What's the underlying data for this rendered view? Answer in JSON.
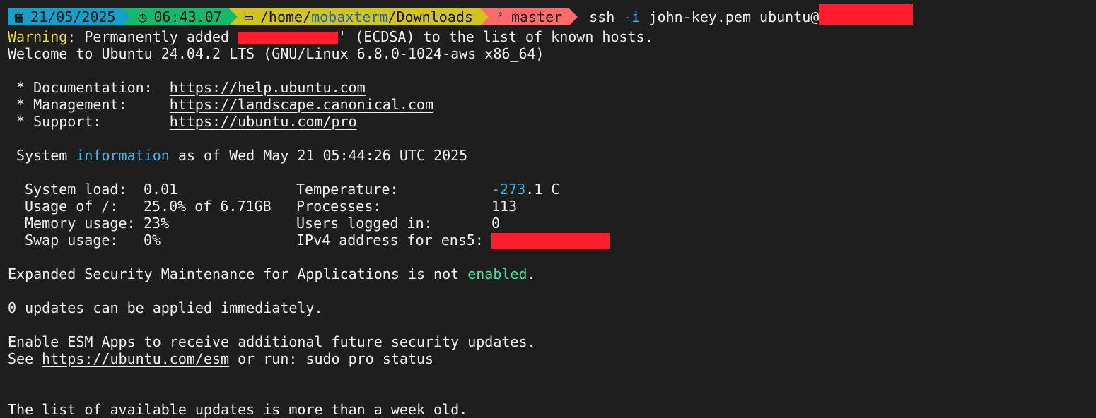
{
  "prompt": {
    "date": "21/05/2025",
    "time": "06:43.07",
    "path_prefix": "/home/",
    "path_user": "mobaxterm",
    "path_suffix": "/Downloads",
    "branch": "master",
    "command_prefix": "ssh ",
    "command_flag": "-i",
    "command_rest": " john-key.pem ubuntu@",
    "colors": {
      "date_bg": "#16a0c8",
      "time_bg": "#16b86a",
      "path_bg": "#d2c41f",
      "git_bg": "#ff6b6b"
    }
  },
  "output": {
    "warning_label": "Warning",
    "warning_text_before": ": Permanently added ",
    "warning_text_after": "' (ECDSA) to the list of known hosts.",
    "welcome": "Welcome to Ubuntu 24.04.2 LTS (GNU/Linux 6.8.0-1024-aws x86_64)",
    "links": [
      {
        "label": " * Documentation:  ",
        "url": "https://help.ubuntu.com"
      },
      {
        "label": " * Management:     ",
        "url": "https://landscape.canonical.com"
      },
      {
        "label": " * Support:        ",
        "url": "https://ubuntu.com/pro"
      }
    ],
    "sysinfo_prefix": " System ",
    "sysinfo_highlight": "information",
    "sysinfo_suffix": " as of Wed May 21 05:44:26 UTC 2025",
    "stats": [
      {
        "label": "System load:",
        "value": "0.01",
        "key": "Temperature:",
        "val": "-273.1 C"
      },
      {
        "label": "Usage of /:",
        "value": "25.0% of 6.71GB",
        "key": "Processes:",
        "val": "113"
      },
      {
        "label": "Memory usage:",
        "value": "23%",
        "key": "Users logged in:",
        "val": "0"
      },
      {
        "label": "Swap usage:",
        "value": "0%",
        "key": "IPv4 address for ens5:",
        "val": ""
      }
    ],
    "temp_negative": "-273",
    "temp_rest": ".1 C",
    "esm_prefix": "Expanded Security Maintenance for Applications is not ",
    "esm_enabled": "enabled",
    "esm_suffix": ".",
    "updates_line": "0 updates can be applied immediately.",
    "esm_apps_line": "Enable ESM Apps to receive additional future security updates.",
    "see_prefix": "See ",
    "see_url": "https://ubuntu.com/esm",
    "see_suffix": " or run: sudo pro status",
    "list_line": "The list of available updates is more than a week old."
  }
}
